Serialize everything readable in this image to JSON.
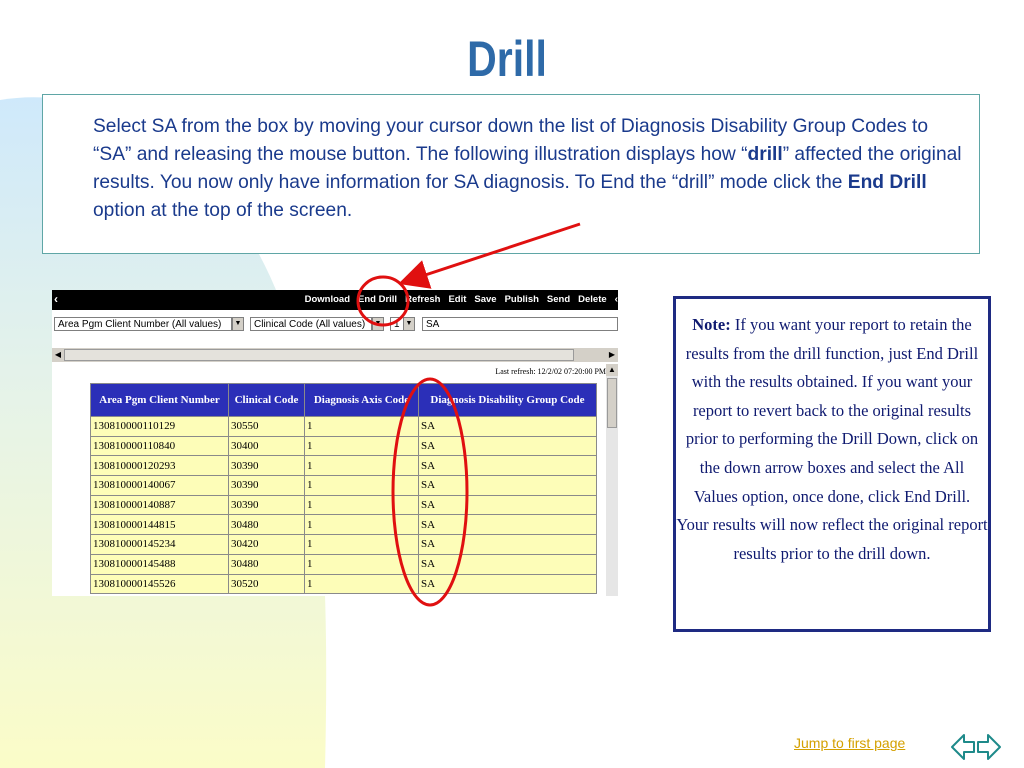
{
  "slide": {
    "title": "Drill",
    "intro_part1": "Select SA from the box by moving your cursor down the list of Diagnosis Disability Group Codes to “SA” and releasing the mouse button.  The following illustration displays how “",
    "intro_bold1": "drill",
    "intro_part2": "” affected the original results.  You now only have information for SA diagnosis.  To End the “drill” mode click the ",
    "intro_bold2": "End Drill",
    "intro_part3": " option at the top of the screen.",
    "note_label": "Note:",
    "note_text": "  If you want your report to retain the results from the drill function, just End Drill with the results obtained.  If you want your report to revert back to the original results prior to performing the Drill Down, click on the down arrow boxes and select the All Values option, once done, click End Drill.  Your results will now reflect the original report results prior to the drill down.",
    "jump_link": "Jump to first page"
  },
  "screenshot": {
    "menu": {
      "back_icon": "‹",
      "download": "Download",
      "end_drill": "End Drill",
      "refresh": "Refresh",
      "edit": "Edit",
      "save": "Save",
      "publish": "Publish",
      "send": "Send",
      "delete": "Delete",
      "forward_icon": "‹"
    },
    "filters": {
      "area": "Area Pgm Client Number (All values)",
      "clinical": "Clinical Code (All values)",
      "axis": "1",
      "group": "SA"
    },
    "last_refresh": "Last refresh: 12/2/02 07:20:00 PM",
    "table": {
      "headers": [
        "Area Pgm Client Number",
        "Clinical Code",
        "Diagnosis Axis Code",
        "Diagnosis Disability Group Code"
      ],
      "rows": [
        [
          "130810000110129",
          "30550",
          "1",
          "SA"
        ],
        [
          "130810000110840",
          "30400",
          "1",
          "SA"
        ],
        [
          "130810000120293",
          "30390",
          "1",
          "SA"
        ],
        [
          "130810000140067",
          "30390",
          "1",
          "SA"
        ],
        [
          "130810000140887",
          "30390",
          "1",
          "SA"
        ],
        [
          "130810000144815",
          "30480",
          "1",
          "SA"
        ],
        [
          "130810000145234",
          "30420",
          "1",
          "SA"
        ],
        [
          "130810000145488",
          "30480",
          "1",
          "SA"
        ],
        [
          "130810000145526",
          "30520",
          "1",
          "SA"
        ]
      ]
    }
  },
  "colors": {
    "title": "#2e6aa8",
    "intro_text": "#1a3a8c",
    "header_bg": "#2b2fb8",
    "cell_bg": "#fdfdb8",
    "annotation_red": "#e01010",
    "link": "#d4a000"
  },
  "icons": {
    "nav": "left-right-arrows-icon"
  }
}
